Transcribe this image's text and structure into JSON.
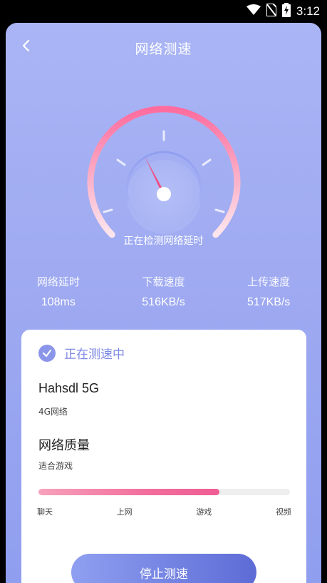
{
  "status_bar": {
    "time": "3:12",
    "icons": [
      "wifi-icon",
      "no-sim-icon",
      "battery-charging-icon"
    ]
  },
  "header": {
    "title": "网络测速",
    "back_icon": "chevron-left-icon"
  },
  "gauge": {
    "status_text": "正在检测网络延时",
    "needle_level": 0.4,
    "colors": {
      "arc_start": "#ff6c9e",
      "arc_end": "#fde6ee",
      "inner_ring": "#8f9ef0",
      "needle": "#ef4f87"
    }
  },
  "stats": [
    {
      "label": "网络延时",
      "value": "108ms"
    },
    {
      "label": "下载速度",
      "value": "516KB/s"
    },
    {
      "label": "上传速度",
      "value": "517KB/s"
    }
  ],
  "card": {
    "status_text": "正在测速中",
    "network_name": "Hahsdl 5G",
    "network_type": "4G网络",
    "quality_title": "网络质量",
    "quality_desc": "适合游戏",
    "quality_level_percent": 72,
    "scale_labels": [
      "聊天",
      "上网",
      "游戏",
      "视频"
    ],
    "stop_button": "停止测速"
  },
  "colors": {
    "accent": "#7d88e6",
    "background_top": "#a9b5f5",
    "background_bottom": "#8f9eef",
    "progress_pink": "#ef5d93"
  }
}
